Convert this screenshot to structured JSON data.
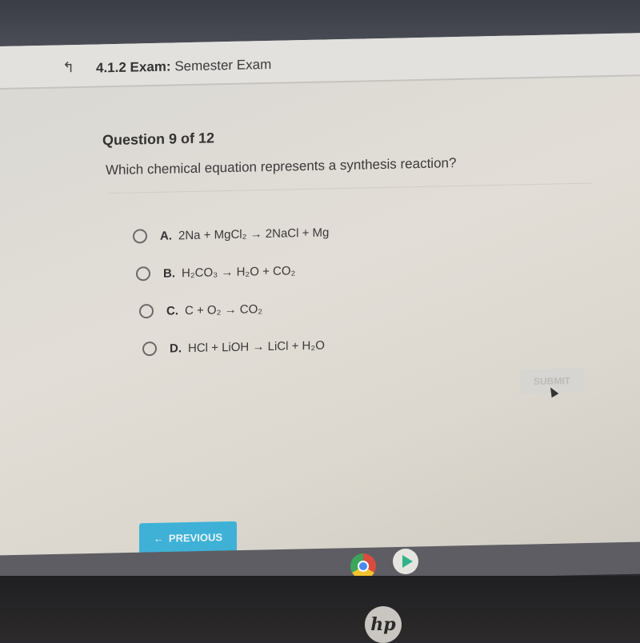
{
  "header": {
    "back_icon": "back-arrow-icon",
    "section": "4.1.2",
    "type_label": "Exam:",
    "name": "Semester Exam"
  },
  "question": {
    "counter": "Question 9 of 12",
    "prompt": "Which chemical equation represents a synthesis reaction?",
    "options": [
      {
        "letter": "A.",
        "equation": "2Na + MgCl₂ → 2NaCl + Mg"
      },
      {
        "letter": "B.",
        "equation": "H₂CO₃ → H₂O + CO₂"
      },
      {
        "letter": "C.",
        "equation": "C + O₂ → CO₂"
      },
      {
        "letter": "D.",
        "equation": "HCl + LiOH → LiCl + H₂O"
      }
    ],
    "selected": null
  },
  "buttons": {
    "submit": "SUBMIT",
    "previous": "PREVIOUS",
    "previous_icon": "arrow-left-icon"
  },
  "taskbar": {
    "apps": [
      "chrome-icon",
      "play-store-icon"
    ]
  },
  "device": {
    "logo": "hp"
  }
}
